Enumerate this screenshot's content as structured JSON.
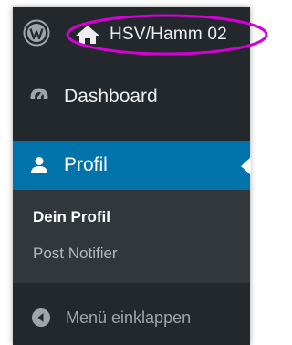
{
  "adminbar": {
    "logo_icon": "wordpress-logo-icon",
    "site_icon": "home-icon",
    "site_name": "HSV/Hamm 02",
    "highlight_color": "#d400d4"
  },
  "menu": {
    "items": [
      {
        "label": "Dashboard",
        "icon": "dashboard-icon"
      },
      {
        "label": "Profil",
        "icon": "user-icon",
        "current": true
      }
    ],
    "submenu": [
      {
        "label": "Dein Profil",
        "active": true
      },
      {
        "label": "Post Notifier",
        "active": false
      }
    ],
    "collapse": {
      "label": "Menü einklappen",
      "icon": "collapse-arrow-icon"
    }
  },
  "colors": {
    "sidebar_bg": "#23282d",
    "submenu_bg": "#32373c",
    "accent": "#0073aa",
    "text": "#eeeeee"
  }
}
